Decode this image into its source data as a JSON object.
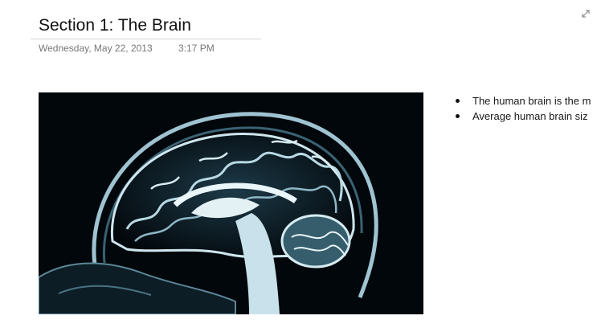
{
  "page": {
    "title": "Section 1: The Brain",
    "date": "Wednesday, May 22, 2013",
    "time": "3:17 PM"
  },
  "icons": {
    "expand": "expand-icon"
  },
  "image": {
    "subject": "brain-mri-sagittal-image"
  },
  "notes": {
    "bullets": [
      "The human brain is the m",
      "Average human brain siz"
    ]
  },
  "colors": {
    "background": "#ffffff",
    "title_text": "#111111",
    "meta_text": "#777777",
    "image_background": "#02070b",
    "scan_tint": "#cfe6ee"
  }
}
